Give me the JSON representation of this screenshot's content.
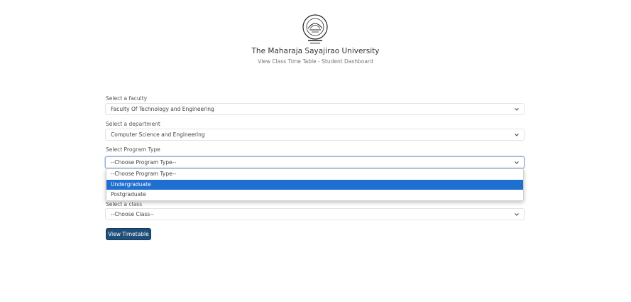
{
  "header": {
    "university_name": "The Maharaja Sayajirao University",
    "subtitle": "View Class Time Table - Student Dashboard"
  },
  "form": {
    "faculty": {
      "label": "Select a faculty",
      "value": "Faculty Of Technology and Engineering"
    },
    "department": {
      "label": "Select a department",
      "value": "Computer Science and Engineering"
    },
    "program_type": {
      "label": "Select Program Type",
      "value": "--Choose Program Type--",
      "options": [
        "--Choose Program Type--",
        "Undergraduate",
        "Postgraduate"
      ],
      "highlighted": "Undergraduate"
    },
    "class": {
      "label": "Select a class",
      "value": "--Choose Class--"
    },
    "submit_label": "View Timetable"
  },
  "colors": {
    "button": "#1f4e79",
    "highlight": "#1f6fd1"
  },
  "icons": {
    "logo": "university-seal-icon",
    "chevron": "chevron-down-icon"
  }
}
